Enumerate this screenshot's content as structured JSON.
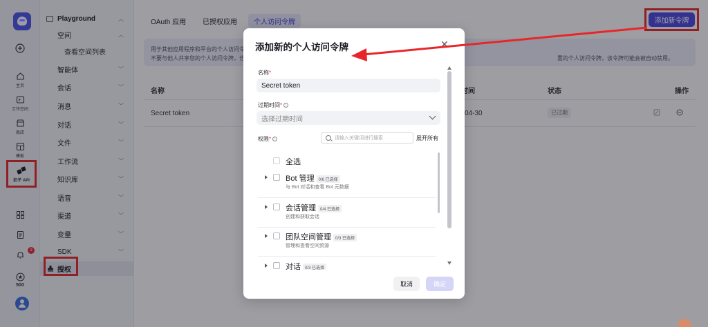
{
  "rail": {
    "items": [
      {
        "name": "create",
        "label": ""
      },
      {
        "name": "home",
        "label": "主页"
      },
      {
        "name": "workspace",
        "label": "工作空间"
      },
      {
        "name": "store",
        "label": "商店"
      },
      {
        "name": "templates",
        "label": "模板"
      },
      {
        "name": "api",
        "label": "扣子 API"
      }
    ],
    "bottom": {
      "notifications_badge": "2",
      "points_label": "500"
    }
  },
  "nav": {
    "header": "Playground",
    "items": [
      {
        "label": "空间",
        "chevron": "up"
      },
      {
        "label": "查看空间列表",
        "sub": true
      },
      {
        "label": "智能体",
        "chevron": "down"
      },
      {
        "label": "会话",
        "chevron": "down"
      },
      {
        "label": "消息",
        "chevron": "down"
      },
      {
        "label": "对话",
        "chevron": "down"
      },
      {
        "label": "文件",
        "chevron": "down"
      },
      {
        "label": "工作流",
        "chevron": "down"
      },
      {
        "label": "知识库",
        "chevron": "down"
      },
      {
        "label": "语音",
        "chevron": "down"
      },
      {
        "label": "渠道",
        "chevron": "down"
      },
      {
        "label": "变量",
        "chevron": "down"
      },
      {
        "label": "SDK",
        "chevron": "down"
      }
    ],
    "active": "授权"
  },
  "main": {
    "tabs": [
      "OAuth 应用",
      "已授权应用",
      "个人访问令牌"
    ],
    "active_tab": "个人访问令牌",
    "add_button": "添加新令牌",
    "info": {
      "line1_left": "用于其他应用程序和平台的个人访问令",
      "line2_left": "不要与他人共享您的个人访问令牌，也",
      "line2_right": "置的个人访问令牌，该令牌可能会被自动禁用。"
    },
    "table": {
      "headers": [
        "名称",
        "时间",
        "状态",
        "操作"
      ],
      "rows": [
        {
          "name": "Secret token",
          "time": "04-30",
          "status": "已过期"
        }
      ]
    }
  },
  "modal": {
    "title": "添加新的个人访问令牌",
    "name_label": "名称",
    "name_value": "Secret token",
    "expiry_label": "过期时间",
    "expiry_placeholder": "选择过期时间",
    "perm_label": "权限",
    "search_placeholder": "请输入关键词进行搜索",
    "expand_all": "展开所有",
    "select_all": "全选",
    "permissions": [
      {
        "name": "Bot 管理",
        "count": "0/6 已选择",
        "desc": "与 Bot 对话和查看 Bot 元数据"
      },
      {
        "name": "会话管理",
        "count": "0/4 已选择",
        "desc": "创建和获取会话"
      },
      {
        "name": "团队空间管理",
        "count": "0/3 已选择",
        "desc": "管理和查看空间资源"
      },
      {
        "name": "对话",
        "count": "0/3 已选择",
        "desc": ""
      }
    ],
    "cancel": "取消",
    "confirm": "确定"
  },
  "colors": {
    "accent": "#4b46e0",
    "highlight": "#e8262a"
  }
}
